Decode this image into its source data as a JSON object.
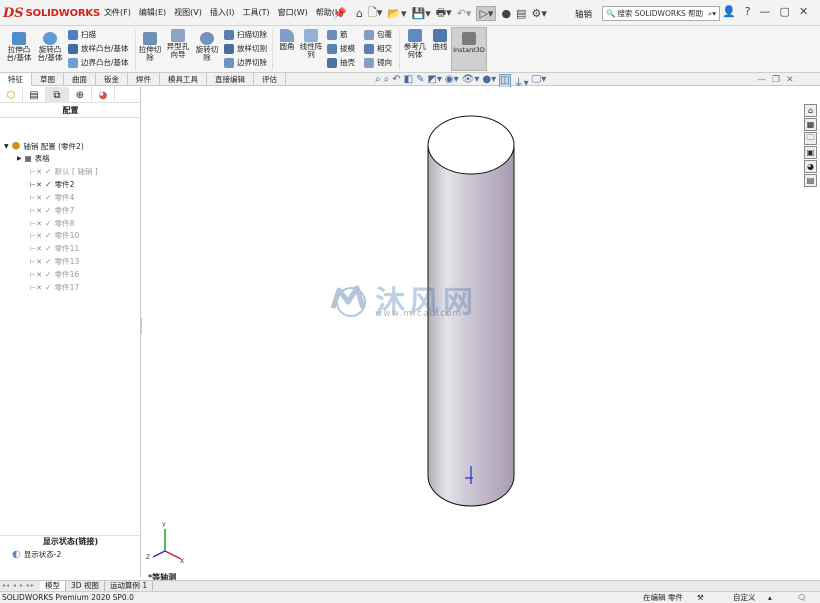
{
  "app": {
    "logo_ds": "DS",
    "logo_text": "SOLIDWORKS",
    "document_title": "轴销",
    "search_placeholder": "搜索 SOLIDWORKS 帮助",
    "help_label": "?"
  },
  "menu": [
    "文件(F)",
    "编辑(E)",
    "视图(V)",
    "插入(I)",
    "工具(T)",
    "窗口(W)",
    "帮助(H)"
  ],
  "ribbon": {
    "extrude_boss": "拉伸凸\n台/基体",
    "revolve_boss": "旋转凸\n台/基体",
    "sweep": "扫描",
    "loft_boss": "放样凸台/基体",
    "boundary_boss": "边界凸台/基体",
    "extrude_cut": "拉伸切\n除",
    "hole_wizard": "异型孔\n向导",
    "revolve_cut": "旋转切\n除",
    "swept_cut": "扫描切除",
    "lofted_cut": "放样切割",
    "boundary_cut": "边界切除",
    "fillet": "圆角",
    "linear_pattern": "线性阵\n列",
    "rib": "筋",
    "draft": "拔模",
    "shell": "抽壳",
    "wrap": "包覆",
    "intersect": "相交",
    "mirror": "镜向",
    "reference_geometry": "参考几\n何体",
    "curves": "曲线",
    "instant3d": "Instant3D"
  },
  "tabs": [
    "特征",
    "草图",
    "曲面",
    "钣金",
    "焊件",
    "模具工具",
    "直接编辑",
    "评估"
  ],
  "panel": {
    "title": "配置",
    "root_label": "轴销 配置 (零件2)",
    "table_label": "表格",
    "configs": [
      {
        "label": "默认 [ 轴销 ]",
        "active": false
      },
      {
        "label": "零件2",
        "active": true
      },
      {
        "label": "零件4",
        "active": false
      },
      {
        "label": "零件7",
        "active": false
      },
      {
        "label": "零件8",
        "active": false
      },
      {
        "label": "零件10",
        "active": false
      },
      {
        "label": "零件11",
        "active": false
      },
      {
        "label": "零件13",
        "active": false
      },
      {
        "label": "零件16",
        "active": false
      },
      {
        "label": "零件17",
        "active": false
      }
    ],
    "display_state_title": "显示状态(链接)",
    "display_state_item": "显示状态-2"
  },
  "viewport": {
    "view_label": "*等轴测",
    "watermark_cn": "沐风网",
    "watermark_url": "www.mfcad.com"
  },
  "bottom_tabs": [
    "模型",
    "3D 视图",
    "运动算例 1"
  ],
  "status": {
    "version": "SOLIDWORKS Premium 2020 SP0.0",
    "mode": "在编辑 零件",
    "units": "自定义"
  },
  "colors": {
    "accent": "#d1241e",
    "check_active": "#0a8a0a",
    "selection_tab": "#d0d0d0"
  }
}
